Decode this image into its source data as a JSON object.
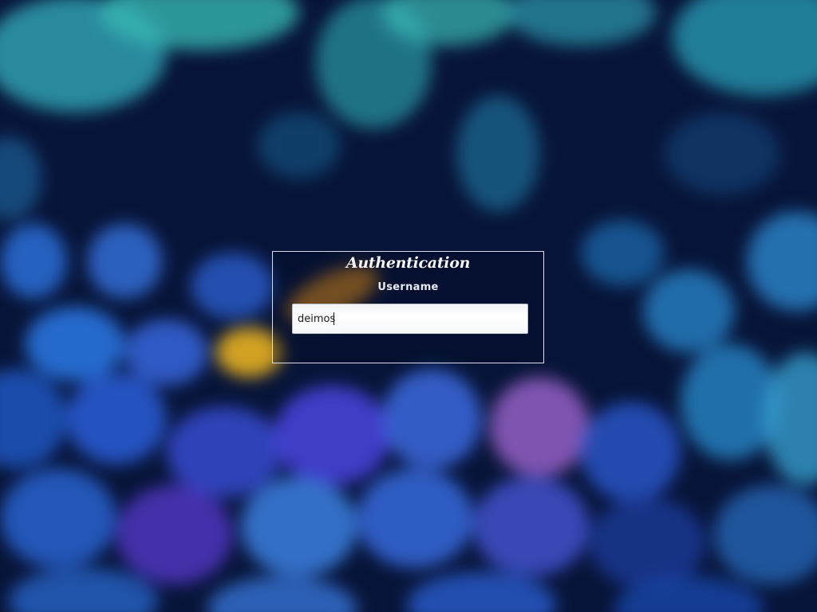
{
  "dialog": {
    "title": "Authentication",
    "field_label": "Username",
    "username_value": "deimos"
  },
  "colors": {
    "background_base": "#061030",
    "box_border": "#d8dde8",
    "text": "#f4f6fa"
  }
}
